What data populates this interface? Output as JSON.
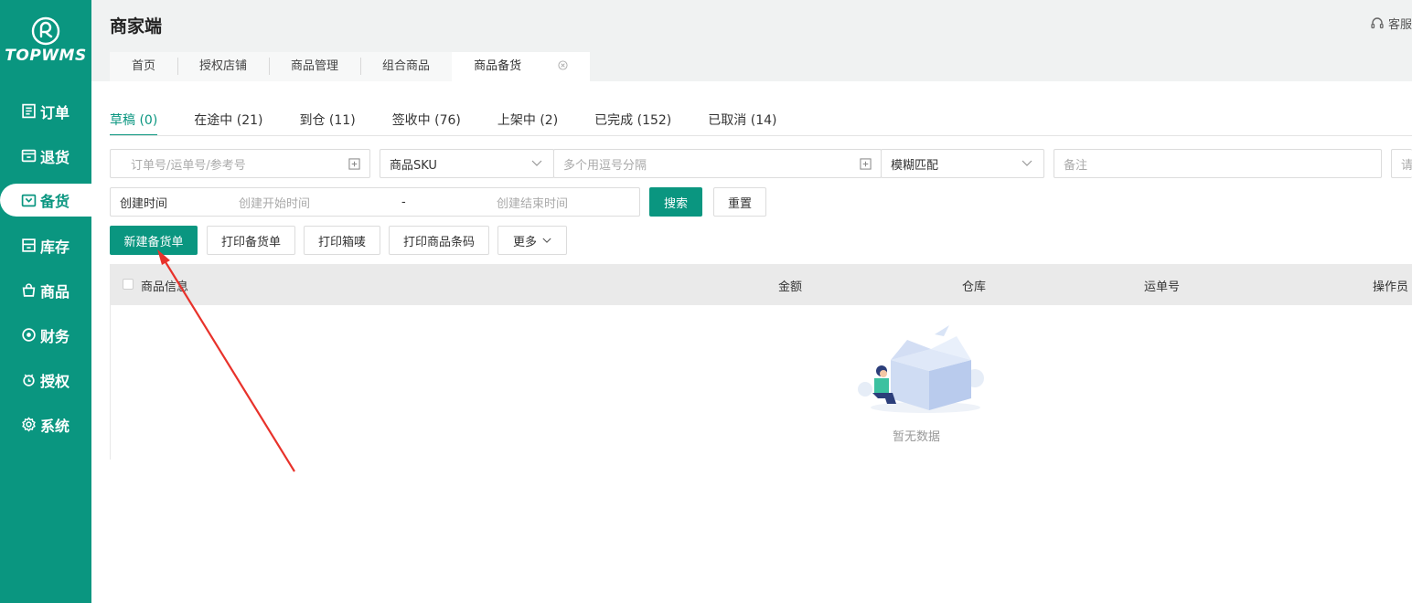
{
  "logo": {
    "text": "TOPWMS"
  },
  "sidebar": {
    "items": [
      {
        "label": "订单",
        "icon": "order-icon",
        "active": false
      },
      {
        "label": "退货",
        "icon": "return-icon",
        "active": false
      },
      {
        "label": "备货",
        "icon": "stock-prep-icon",
        "active": true
      },
      {
        "label": "库存",
        "icon": "inventory-icon",
        "active": false
      },
      {
        "label": "商品",
        "icon": "bag-icon",
        "active": false
      },
      {
        "label": "财务",
        "icon": "finance-icon",
        "active": false
      },
      {
        "label": "授权",
        "icon": "auth-icon",
        "active": false
      },
      {
        "label": "系统",
        "icon": "gear-icon",
        "active": false
      }
    ]
  },
  "header": {
    "title": "商家端",
    "service_label": "客服",
    "tabs": [
      {
        "label": "首页"
      },
      {
        "label": "授权店铺"
      },
      {
        "label": "商品管理"
      },
      {
        "label": "组合商品"
      },
      {
        "label": "商品备货",
        "active": true
      }
    ]
  },
  "status_tabs": [
    {
      "label": "草稿 (0)",
      "active": true
    },
    {
      "label": "在途中 (21)"
    },
    {
      "label": "到仓 (11)"
    },
    {
      "label": "签收中 (76)"
    },
    {
      "label": "上架中 (2)"
    },
    {
      "label": "已完成 (152)"
    },
    {
      "label": "已取消 (14)"
    }
  ],
  "filters": {
    "order_placeholder": "订单号/运单号/参考号",
    "sku_select": "商品SKU",
    "sku_placeholder": "多个用逗号分隔",
    "match_select": "模糊匹配",
    "remark_placeholder": "备注",
    "extra_placeholder": "请",
    "time_label": "创建时间",
    "start_placeholder": "创建开始时间",
    "range_sep": "-",
    "end_placeholder": "创建结束时间",
    "search_label": "搜索",
    "reset_label": "重置"
  },
  "actions": {
    "new_label": "新建备货单",
    "print_order_label": "打印备货单",
    "print_box_label": "打印箱唛",
    "print_barcode_label": "打印商品条码",
    "more_label": "更多"
  },
  "table": {
    "columns": [
      "商品信息",
      "金额",
      "仓库",
      "运单号",
      "操作员"
    ],
    "empty_text": "暂无数据"
  },
  "colors": {
    "brand": "#0a9680",
    "annotation": "#e8322b"
  }
}
